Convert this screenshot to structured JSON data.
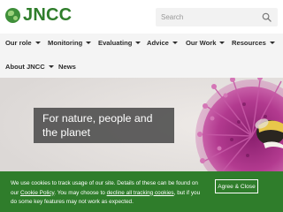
{
  "brand": {
    "logo_text": "JNCC",
    "color": "#2f7d2b"
  },
  "search": {
    "placeholder": "Search"
  },
  "nav": {
    "items": [
      {
        "label": "Our role",
        "has_dropdown": true
      },
      {
        "label": "Monitoring",
        "has_dropdown": true
      },
      {
        "label": "Evaluating",
        "has_dropdown": true
      },
      {
        "label": "Advice",
        "has_dropdown": true
      },
      {
        "label": "Our Work",
        "has_dropdown": true
      },
      {
        "label": "Resources",
        "has_dropdown": true
      },
      {
        "label": "About JNCC",
        "has_dropdown": true
      },
      {
        "label": "News",
        "has_dropdown": false
      }
    ]
  },
  "hero": {
    "tagline": "For nature, people and the planet"
  },
  "cookie": {
    "text_1": "We use cookies to track usage of our site. Details of these can be found on our ",
    "link_policy": "Cookie Policy",
    "text_2": ". You may choose to ",
    "link_decline": "decline all tracking cookies",
    "text_3": ", but if you do some key features may not work as expected.",
    "agree_label": "Agree & Close"
  },
  "colors": {
    "nav_bg": "#f4f4f4",
    "cookie_bg": "#2f7d2b",
    "hero_caption_bg": "#464646"
  }
}
